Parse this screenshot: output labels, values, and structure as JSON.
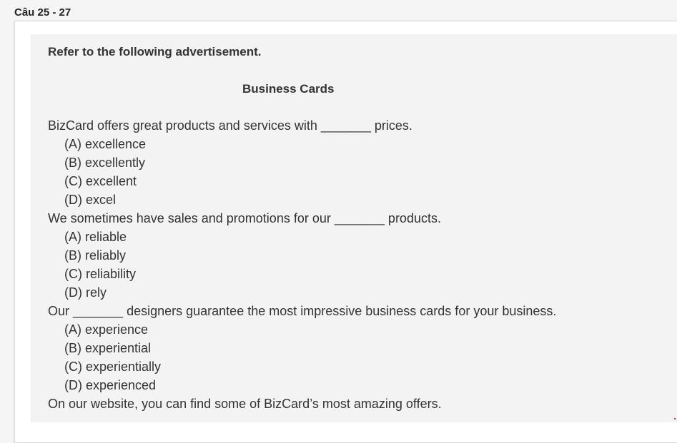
{
  "header": {
    "question_range": "Câu 25 - 27"
  },
  "passage": {
    "intro": "Refer to the following advertisement.",
    "title": "Business Cards",
    "lines": [
      {
        "kind": "sentence",
        "text": "BizCard offers great products and services with _______ prices."
      },
      {
        "kind": "option",
        "text": "(A) excellence"
      },
      {
        "kind": "option",
        "text": "(B) excellently"
      },
      {
        "kind": "option",
        "text": "(C) excellent"
      },
      {
        "kind": "option",
        "text": "(D) excel"
      },
      {
        "kind": "sentence",
        "text": "We sometimes have sales and promotions for our _______ products."
      },
      {
        "kind": "option",
        "text": "(A) reliable"
      },
      {
        "kind": "option",
        "text": "(B) reliably"
      },
      {
        "kind": "option",
        "text": "(C) reliability"
      },
      {
        "kind": "option",
        "text": "(D) rely"
      },
      {
        "kind": "sentence",
        "text": "Our _______ designers guarantee the most impressive business cards for your business."
      },
      {
        "kind": "option",
        "text": "(A) experience"
      },
      {
        "kind": "option",
        "text": "(B) experiential"
      },
      {
        "kind": "option",
        "text": "(C) experientially"
      },
      {
        "kind": "option",
        "text": "(D) experienced"
      },
      {
        "kind": "sentence",
        "text": "On our website, you can find some of BizCard’s most amazing offers."
      }
    ]
  }
}
